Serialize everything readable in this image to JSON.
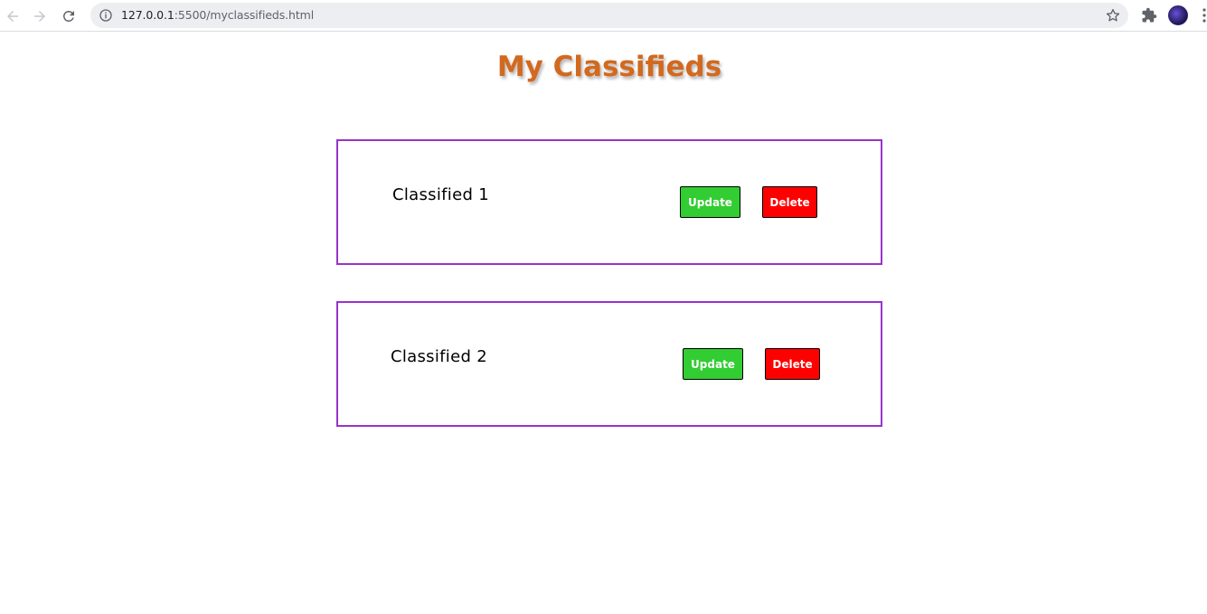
{
  "browser": {
    "url_host": "127.0.0.1",
    "url_rest": ":5500/myclassifieds.html",
    "icons": {
      "back": "back-arrow-icon",
      "forward": "forward-arrow-icon",
      "reload": "reload-icon",
      "info": "info-icon",
      "bookmark": "star-icon",
      "extensions": "puzzle-icon",
      "profile": "avatar",
      "menu": "more-vert-icon"
    }
  },
  "page": {
    "title": "My Classifieds",
    "title_color": "#d2691e",
    "card_border_color": "#9932cc"
  },
  "classifieds": [
    {
      "title": "Classified 1",
      "update_label": "Update",
      "delete_label": "Delete"
    },
    {
      "title": "Classified 2",
      "update_label": "Update",
      "delete_label": "Delete"
    }
  ],
  "colors": {
    "update_button": "#32cd32",
    "delete_button": "#ff0000"
  }
}
